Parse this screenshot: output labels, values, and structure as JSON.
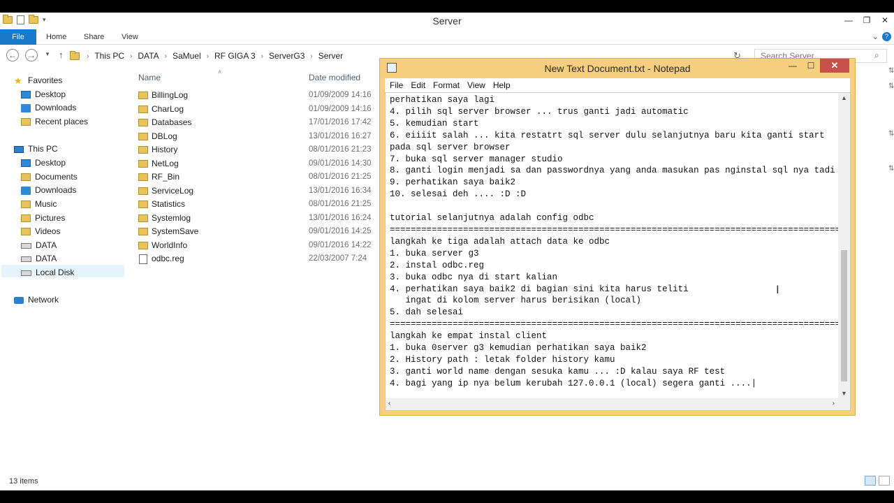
{
  "explorer": {
    "title": "Server",
    "ribbon_tabs": [
      "File",
      "Home",
      "Share",
      "View"
    ],
    "breadcrumb": [
      "This PC",
      "DATA",
      "SaMuel",
      "RF GIGA 3",
      "ServerG3",
      "Server"
    ],
    "search_placeholder": "Search Server",
    "nav": {
      "favorites": "Favorites",
      "fav_items": [
        "Desktop",
        "Downloads",
        "Recent places"
      ],
      "this_pc": "This PC",
      "pc_items": [
        "Desktop",
        "Documents",
        "Downloads",
        "Music",
        "Pictures",
        "Videos",
        "DATA"
      ],
      "data_selected": "DATA",
      "local_disk": "Local Disk",
      "network": "Network"
    },
    "columns": {
      "name": "Name",
      "date": "Date modified"
    },
    "files": [
      {
        "name": "BillingLog",
        "date": "01/09/2009 14:16"
      },
      {
        "name": "CharLog",
        "date": "01/09/2009 14:16"
      },
      {
        "name": "Databases",
        "date": "17/01/2016 17:42"
      },
      {
        "name": "DBLog",
        "date": "13/01/2016 16:27"
      },
      {
        "name": "History",
        "date": "08/01/2016 21:23"
      },
      {
        "name": "NetLog",
        "date": "09/01/2016 14:30"
      },
      {
        "name": "RF_Bin",
        "date": "08/01/2016 21:25"
      },
      {
        "name": "ServiceLog",
        "date": "13/01/2016 16:34"
      },
      {
        "name": "Statistics",
        "date": "08/01/2016 21:25"
      },
      {
        "name": "Systemlog",
        "date": "13/01/2016 16:24"
      },
      {
        "name": "SystemSave",
        "date": "09/01/2016 14:25"
      },
      {
        "name": "WorldInfo",
        "date": "09/01/2016 14:22"
      },
      {
        "name": "odbc.reg",
        "date": "22/03/2007 7:24"
      }
    ],
    "status": "13 items"
  },
  "notepad": {
    "title": "New Text Document.txt - Notepad",
    "menu": [
      "File",
      "Edit",
      "Format",
      "View",
      "Help"
    ],
    "lines": [
      "perhatikan saya lagi",
      "4. pilih sql server browser ... trus ganti jadi automatic",
      "5. kemudian start",
      "6. eiiiit salah ... kita restatrt sql server dulu selanjutnya baru kita ganti start",
      "pada sql server browser",
      "7. buka sql server manager studio",
      "8. ganti login menjadi sa dan passwordnya yang anda masukan pas nginstal sql nya tadi",
      "9. perhatikan saya baik2",
      "10. selesai deh .... :D :D",
      "",
      "tutorial selanjutnya adalah config odbc",
      "=============================================================================================",
      "langkah ke tiga adalah attach data ke odbc",
      "1. buka server g3",
      "2. instal odbc.reg",
      "3. buka odbc nya di start kalian",
      "4. perhatikan saya baik2 di bagian sini kita harus teliti",
      "   ingat di kolom server harus berisikan (local)",
      "5. dah selesai",
      "=============================================================================================",
      "langkah ke empat instal client",
      "1. buka 0server g3 kemudian perhatikan saya baik2",
      "2. History path : letak folder history kamu",
      "3. ganti world name dengan sesuka kamu ... :D kalau saya RF test",
      "4. bagi yang ip nya belum kerubah 127.0.0.1 (local) segera ganti ....|"
    ]
  }
}
